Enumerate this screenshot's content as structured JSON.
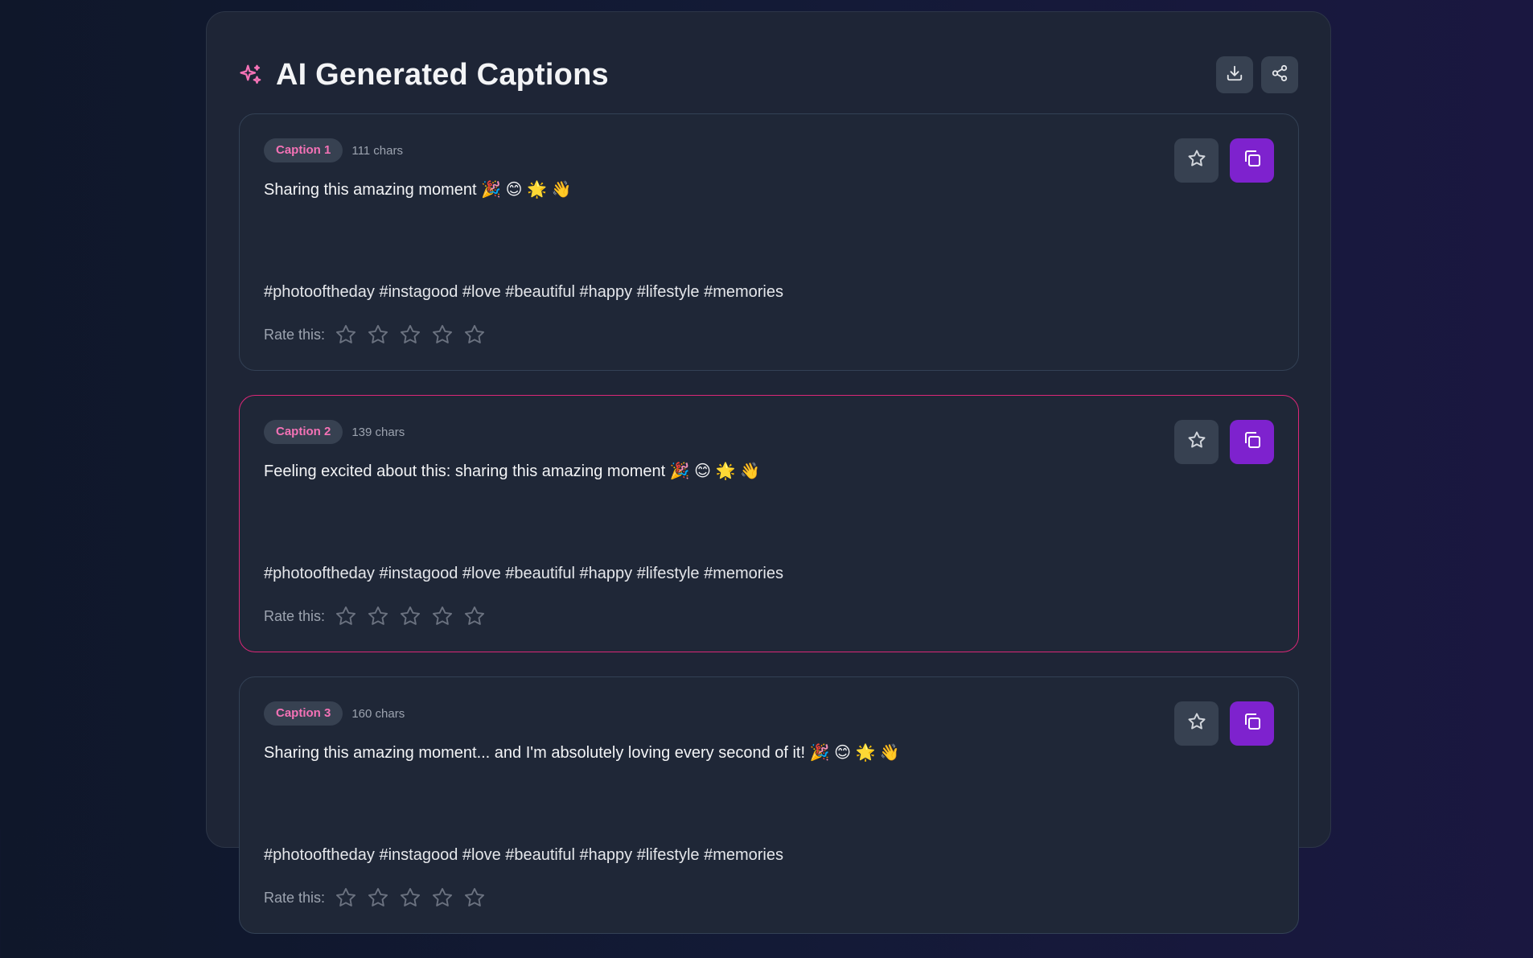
{
  "header": {
    "title": "AI Generated Captions",
    "icon": "sparkles-icon",
    "actions": [
      {
        "name": "download-button",
        "icon": "download-icon"
      },
      {
        "name": "share-button",
        "icon": "share-icon"
      }
    ]
  },
  "colors": {
    "accent_pink": "#f472b6",
    "selected_border": "#db2777",
    "copy_button": "#7e22ce",
    "panel": "#1e2536"
  },
  "captions": [
    {
      "badge": "Caption 1",
      "chars": "111 chars",
      "text": "Sharing this amazing moment 🎉 😊 🌟 👋",
      "hashtags": "#photooftheday #instagood #love #beautiful #happy #lifestyle #memories",
      "rate_label": "Rate this:",
      "rating": 0,
      "selected": false
    },
    {
      "badge": "Caption 2",
      "chars": "139 chars",
      "text": "Feeling excited about this: sharing this amazing moment 🎉 😊 🌟 👋",
      "hashtags": "#photooftheday #instagood #love #beautiful #happy #lifestyle #memories",
      "rate_label": "Rate this:",
      "rating": 0,
      "selected": true
    },
    {
      "badge": "Caption 3",
      "chars": "160 chars",
      "text": "Sharing this amazing moment... and I'm absolutely loving every second of it! 🎉 😊 🌟 👋",
      "hashtags": "#photooftheday #instagood #love #beautiful #happy #lifestyle #memories",
      "rate_label": "Rate this:",
      "rating": 0,
      "selected": false
    }
  ]
}
